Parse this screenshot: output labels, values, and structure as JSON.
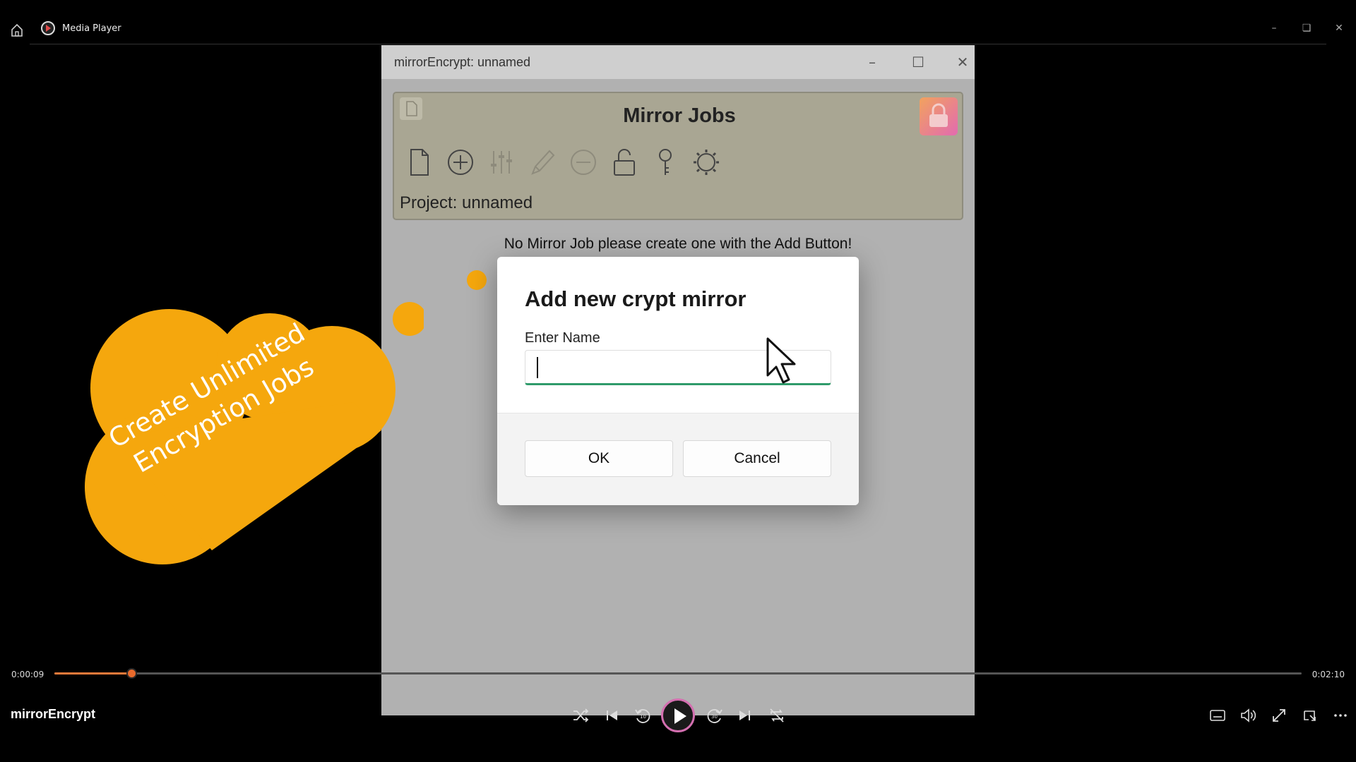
{
  "player": {
    "title": "Media Player",
    "window_controls": [
      "minimize",
      "restore",
      "close"
    ],
    "current_time": "0:00:09",
    "total_time": "0:02:10",
    "progress_fraction": 0.0615,
    "video_name": "mirrorEncrypt",
    "accent_color": "#f07a3a"
  },
  "app": {
    "window_title": "mirrorEncrypt: unnamed",
    "heading": "Mirror Jobs",
    "project_label": "Project: unnamed",
    "empty_message": "No Mirror Job please create one with the Add Button!",
    "toolbar_icons": [
      "new-document-icon",
      "add-icon",
      "sliders-icon",
      "edit-pencil-icon",
      "remove-icon",
      "unlock-icon",
      "key-icon",
      "settings-gear-icon"
    ],
    "panel_color": "#a9a693"
  },
  "dialog": {
    "title": "Add new crypt mirror",
    "field_label": "Enter Name",
    "field_value": "",
    "ok_label": "OK",
    "cancel_label": "Cancel",
    "focus_color": "#2f9b6a"
  },
  "overlay": {
    "line1": "Create Unlimited",
    "line2": "Encryption Jobs",
    "cloud_color": "#f5a70d"
  }
}
